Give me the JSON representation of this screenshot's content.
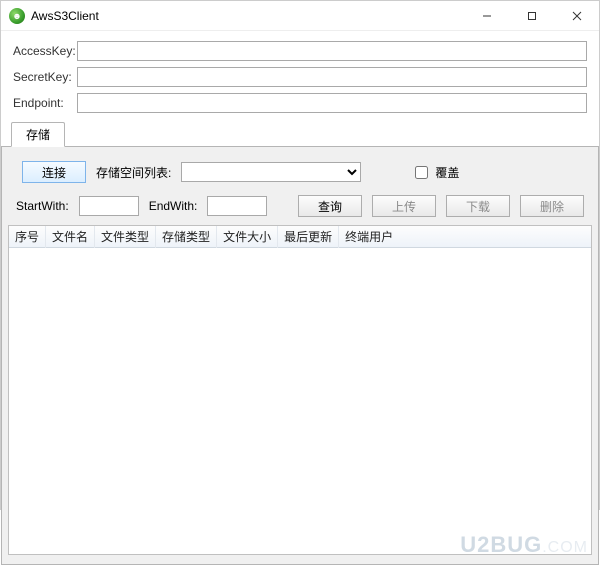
{
  "window": {
    "title": "AwsS3Client"
  },
  "form": {
    "accessKeyLabel": "AccessKey:",
    "secretKeyLabel": "SecretKey:",
    "endpointLabel": "Endpoint:",
    "accessKeyValue": "",
    "secretKeyValue": "",
    "endpointValue": ""
  },
  "tabs": {
    "storage": "存储"
  },
  "controls": {
    "connect": "连接",
    "bucketListLabel": "存储空间列表:",
    "overwrite": "覆盖",
    "startWithLabel": "StartWith:",
    "endWithLabel": "EndWith:",
    "startWithValue": "",
    "endWithValue": "",
    "query": "查询",
    "upload": "上传",
    "download": "下载",
    "delete": "删除"
  },
  "columns": {
    "index": "序号",
    "fileName": "文件名",
    "fileType": "文件类型",
    "storageType": "存储类型",
    "fileSize": "文件大小",
    "lastUpdate": "最后更新",
    "endUser": "终端用户"
  },
  "watermark": {
    "main": "U2BUG",
    "sub": ".COM"
  }
}
